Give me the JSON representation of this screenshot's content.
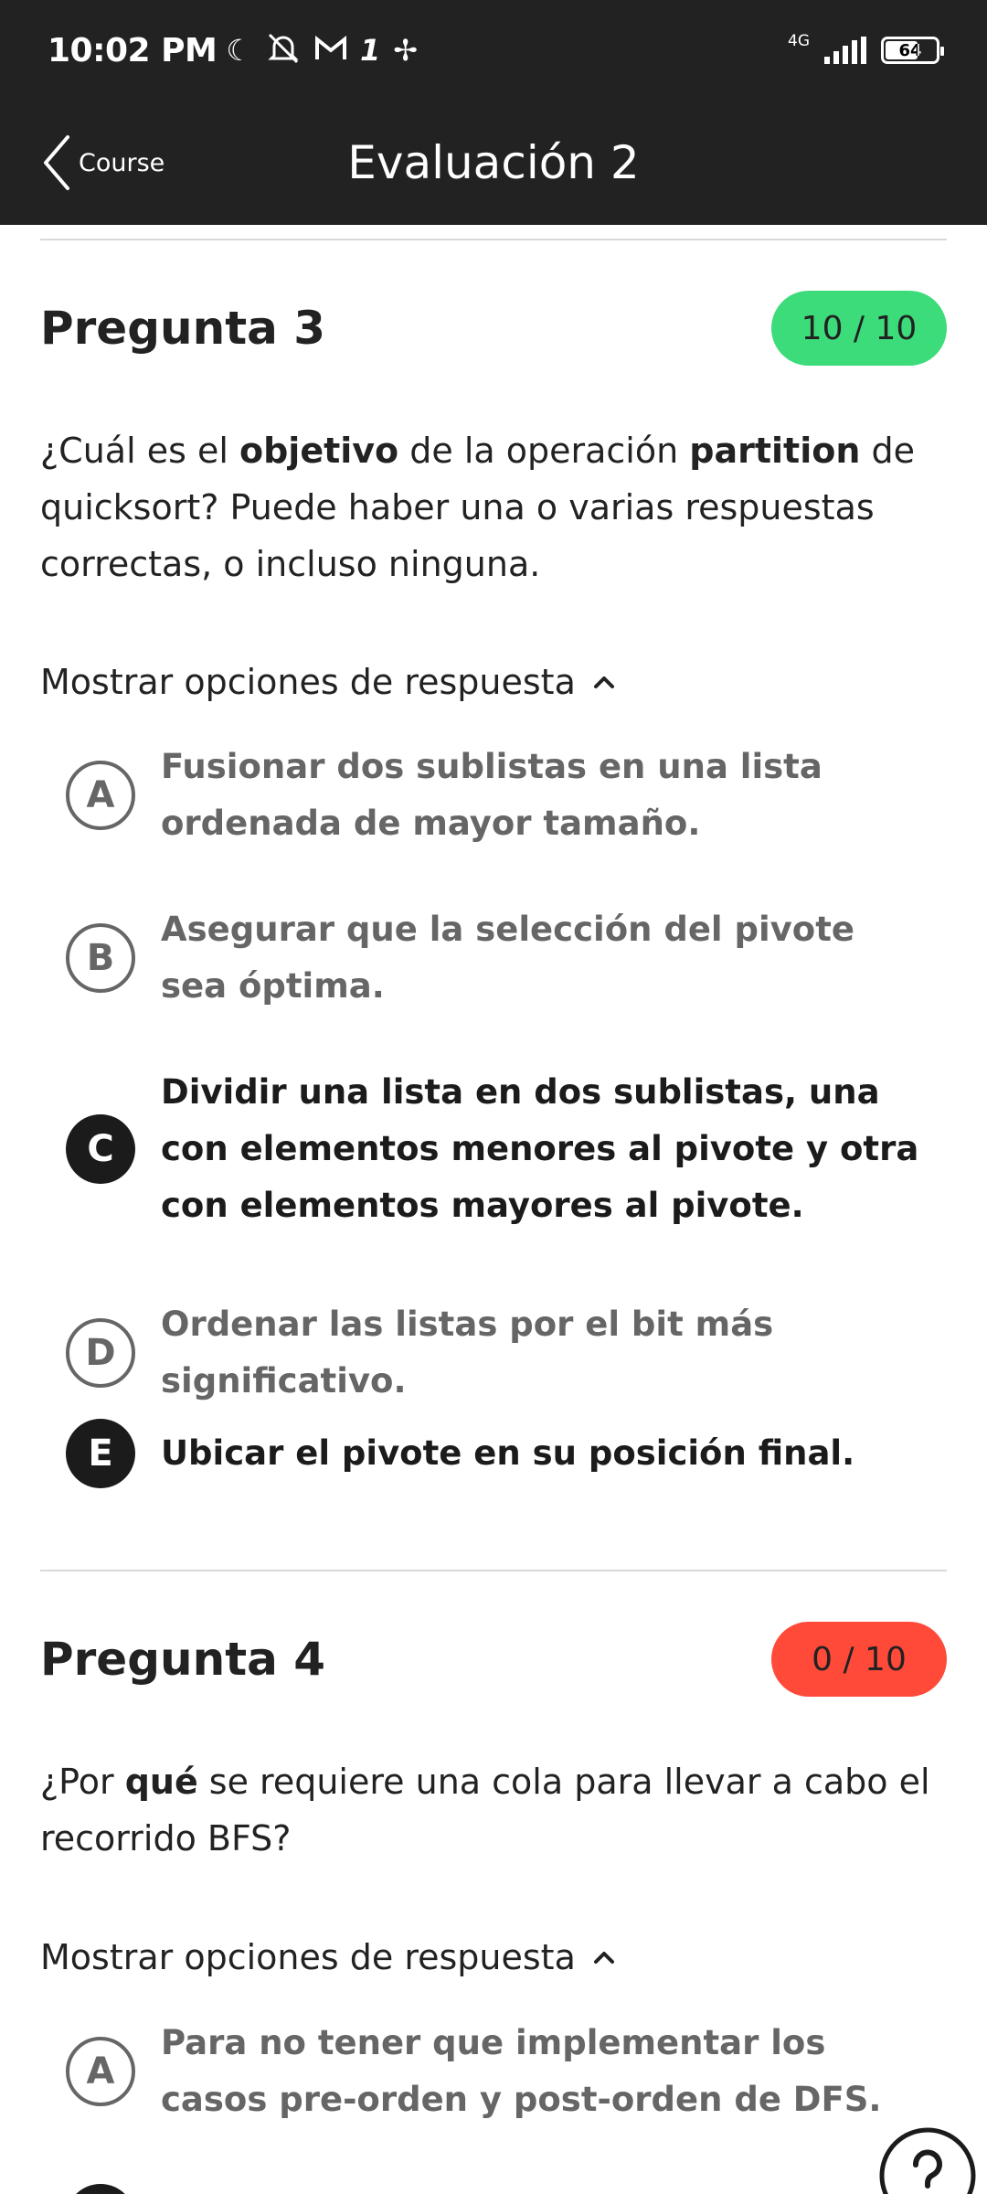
{
  "status_bar": {
    "time": "10:02 PM",
    "icons": [
      "moon-icon",
      "bell-off-icon",
      "gmail-icon",
      "app-icon",
      "pinwheel-icon"
    ],
    "network": "4G",
    "battery": "64",
    "battery_level": 0.64
  },
  "app_bar": {
    "back_label": "Course",
    "title": "Evaluación 2"
  },
  "questions": [
    {
      "title": "Pregunta 3",
      "score": "10 / 10",
      "score_color": "#3ddc7a",
      "text_parts": [
        "¿Cuál es el ",
        "objetivo",
        " de la operación ",
        "partition",
        " de quicksort? Puede haber una o varias respuestas correctas, o incluso ninguna."
      ],
      "toggle_label": "Mostrar opciones de respuesta",
      "options": [
        {
          "letter": "A",
          "text": "Fusionar dos sublistas en una lista ordenada de mayor tamaño.",
          "selected": false
        },
        {
          "letter": "B",
          "text": "Asegurar que la selección del pivote sea óptima.",
          "selected": false
        },
        {
          "letter": "C",
          "text": "Dividir una lista en dos sublistas, una con elementos menores al pivote y otra con elementos mayores al pivote.",
          "selected": true
        },
        {
          "letter": "D",
          "text": "Ordenar las listas por el bit más significativo.",
          "selected": false
        },
        {
          "letter": "E",
          "text": "Ubicar el pivote en su posición final.",
          "selected": true
        }
      ]
    },
    {
      "title": "Pregunta 4",
      "score": "0 / 10",
      "score_color": "#ff4a3a",
      "text_parts": [
        "¿Por ",
        "qué",
        " se requiere una cola para llevar a cabo el recorrido BFS?"
      ],
      "toggle_label": "Mostrar opciones de respuesta",
      "options": [
        {
          "letter": "A",
          "text": "Para no tener que implementar los casos pre-orden y post-orden de DFS.",
          "selected": false
        }
      ]
    }
  ],
  "help_button": "help-icon"
}
